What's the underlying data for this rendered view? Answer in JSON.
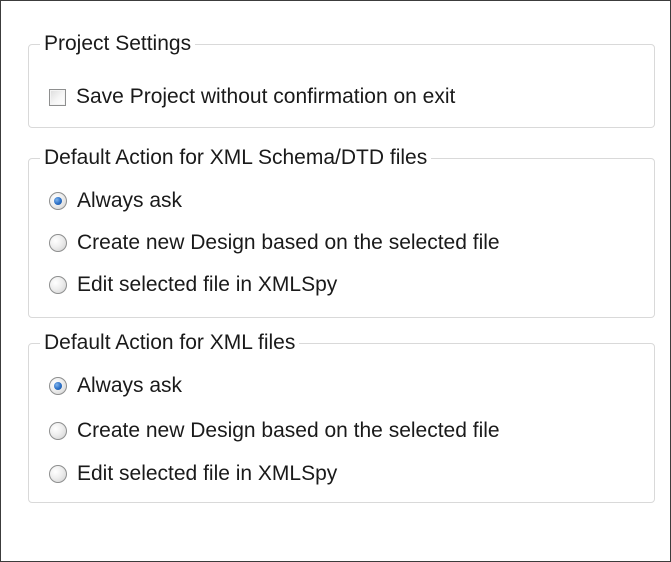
{
  "project_settings": {
    "legend": "Project Settings",
    "save_without_confirmation": {
      "label": "Save Project without confirmation on exit",
      "checked": false
    }
  },
  "schema_dtd_group": {
    "legend": "Default Action for XML Schema/DTD files",
    "selected": "Always ask",
    "options": [
      {
        "label": "Always ask",
        "checked": true
      },
      {
        "label": "Create new Design based on the selected file",
        "checked": false
      },
      {
        "label": "Edit selected file in XMLSpy",
        "checked": false
      }
    ]
  },
  "xml_group": {
    "legend": "Default Action for XML files",
    "selected": "Always ask",
    "options": [
      {
        "label": "Always ask",
        "checked": true
      },
      {
        "label": "Create new Design based on the selected file",
        "checked": false
      },
      {
        "label": "Edit selected file in XMLSpy",
        "checked": false
      }
    ]
  },
  "colors": {
    "radio_selected": "#2a6fc6",
    "group_border": "#d9d9d9",
    "panel_border": "#3c3c3c"
  }
}
